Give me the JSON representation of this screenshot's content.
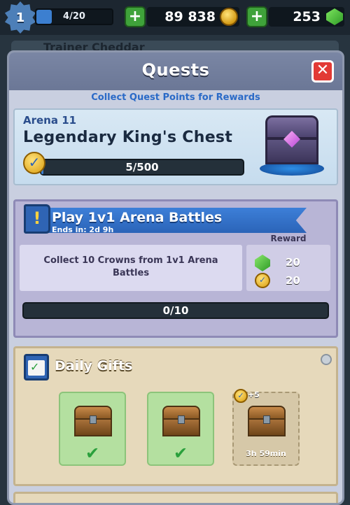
{
  "topbar": {
    "level": "1",
    "xp": "4/20",
    "xp_fraction": 0.2,
    "gold": "89 838",
    "gems": "253"
  },
  "background": {
    "player_name": "Trainer Cheddar"
  },
  "modal": {
    "title": "Quests",
    "close_label": "✕",
    "subtitle": "Collect Quest Points for Rewards",
    "arena": {
      "label": "Arena 11",
      "chest_name": "Legendary King's Chest",
      "progress": "5/500",
      "progress_fraction": 0.01
    },
    "quest": {
      "title": "Play 1v1 Arena Battles",
      "ends_in": "Ends in: 2d 9h",
      "description": "Collect 10 Crowns from 1v1 Arena Battles",
      "reward_label": "Reward",
      "reward_gems": "20",
      "reward_points": "20",
      "progress": "0/10"
    },
    "daily_gifts": {
      "title": "Daily Gifts",
      "slots": [
        {
          "state": "claimed",
          "check": "✔"
        },
        {
          "state": "claimed",
          "check": "✔"
        },
        {
          "state": "locked",
          "bonus": "+5",
          "timer": "3h 59min"
        }
      ]
    }
  },
  "colors": {
    "accent_blue": "#3c7fd0",
    "close_red": "#e23a35",
    "gem_green": "#3fa23a",
    "gold": "#d49b15"
  }
}
